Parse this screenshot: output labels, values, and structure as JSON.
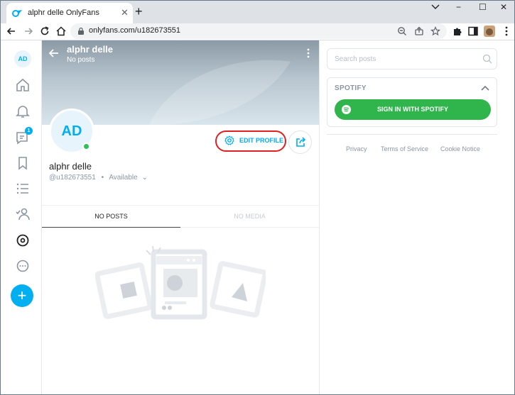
{
  "browser": {
    "tab_title": "alphr delle OnlyFans",
    "tab_close": "✕",
    "new_tab": "+",
    "window_min": "−",
    "window_max": "☐",
    "window_close": "✕",
    "url": "onlyfans.com/u182673551"
  },
  "nav": {
    "avatar_initials": "AD",
    "messages_badge": "1",
    "fab_label": "+"
  },
  "profile": {
    "cover_title": "alphr delle",
    "cover_subtitle": "No posts",
    "avatar_initials": "AD",
    "edit_profile_label": "EDIT PROFILE",
    "name": "alphr delle",
    "handle": "@u182673551",
    "status": "Available",
    "status_separator": "•",
    "status_chevron": "⌄",
    "tabs": [
      "NO POSTS",
      "NO MEDIA"
    ]
  },
  "sidebar": {
    "search_placeholder": "Search posts",
    "spotify_title": "SPOTIFY",
    "spotify_button": "SIGN IN WITH SPOTIFY",
    "footer_links": [
      "Privacy",
      "Terms of Service",
      "Cookie Notice"
    ]
  },
  "colors": {
    "accent": "#00aff0",
    "spotify_green": "#2fb54c",
    "highlight_red": "#e02020",
    "online_green": "#2ebf55"
  },
  "icons": {
    "nav": [
      "home-icon",
      "bell-icon",
      "messages-icon",
      "bookmark-icon",
      "list-icon",
      "user-follow-icon",
      "profile-icon",
      "more-icon"
    ]
  }
}
